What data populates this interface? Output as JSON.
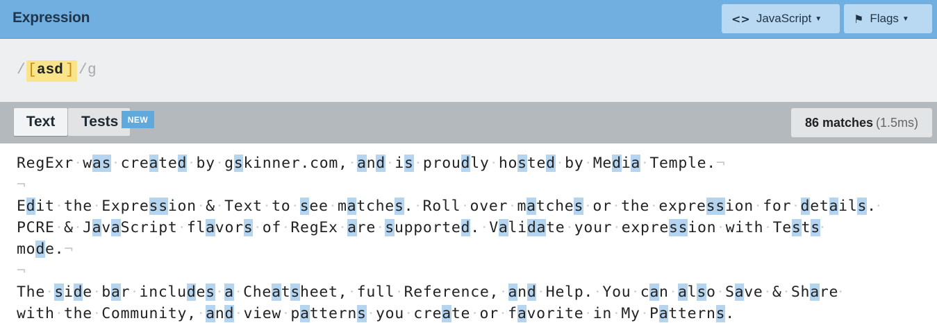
{
  "header": {
    "title": "Expression",
    "language_label": "JavaScript",
    "flags_label": "Flags"
  },
  "expression": {
    "open_slash": "/",
    "open_bracket": "[",
    "chars": "asd",
    "close_bracket": "]",
    "close_slash": "/",
    "flags": "g"
  },
  "tabs": {
    "text_label": "Text",
    "tests_label": "Tests",
    "new_badge": "NEW"
  },
  "status": {
    "matches": "86 matches",
    "time": "(1.5ms)"
  },
  "text_lines": [
    "RegExr was created by gskinner.com, and is proudly hosted by Media Temple.",
    "",
    "Edit the Expression & Text to see matches. Roll over matches or the expression for details.",
    "PCRE & JavaScript flavors of RegEx are supported. Validate your expression with Tests",
    "mode.",
    "",
    "The side bar includes a Cheatsheet, full Reference, and Help. You can also Save & Share",
    "with the Community, and view patterns you create or favorite in My Patterns."
  ],
  "colors": {
    "header_bg": "#70afdf",
    "match_highlight": "#b4d4f0",
    "char_class_bg": "#f8e58b"
  }
}
